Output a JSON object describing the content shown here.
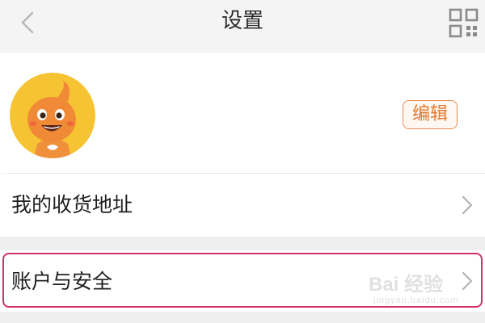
{
  "header": {
    "title": "设置",
    "back_icon": "chevron-left-icon",
    "qr_icon": "qr-code-icon"
  },
  "profile": {
    "avatar_icon": "mascot-avatar-icon",
    "edit_label": "编辑"
  },
  "menu": {
    "items": [
      {
        "label": "我的收货地址",
        "icon": "chevron-right-icon"
      },
      {
        "label": "账户与安全",
        "icon": "chevron-right-icon",
        "highlighted": true
      }
    ]
  },
  "watermark": {
    "text": "Bai 经验",
    "sub": "jingyan.baidu.com"
  },
  "colors": {
    "accent": "#e4782e",
    "highlight_border": "#d4306b",
    "background": "#efeff0"
  }
}
